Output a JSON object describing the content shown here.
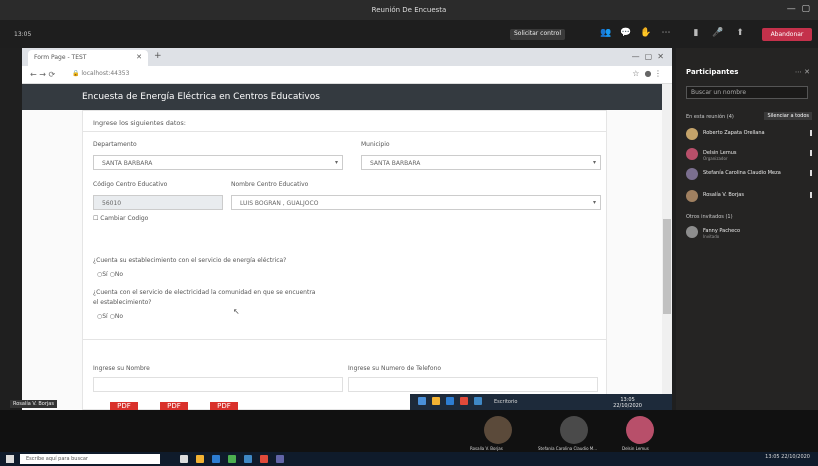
{
  "teams": {
    "window_title": "Reunión De Encuesta",
    "meeting_time": "13:05",
    "control_button": "Solicitar control",
    "leave_button": "Abandonar"
  },
  "browser": {
    "tab_title": "Form Page - TEST",
    "url": "localhost:44353"
  },
  "page": {
    "navbar_title": "Encuesta de Energía Eléctrica en Centros Educativos",
    "instruction": "Ingrese los siguientes datos:",
    "departamento_label": "Departamento",
    "departamento_value": "SANTA BARBARA",
    "municipio_label": "Municipio",
    "municipio_value": "SANTA BARBARA",
    "codigo_label": "Código Centro Educativo",
    "codigo_value": "56010",
    "nombre_centro_label": "Nombre Centro Educativo",
    "nombre_centro_value": "LUIS BOGRAN , GUALJOCO",
    "cambiar_codigo": "Cambiar Codigo",
    "q1": "¿Cuenta su establecimiento con el servicio de energía eléctrica?",
    "q2_line1": "¿Cuenta con el servicio de electricidad la comunidad en que se encuentra",
    "q2_line2": "el establecimiento?",
    "opt_si": "Sí",
    "opt_no": "No",
    "nombre_label": "Ingrese su Nombre",
    "telefono_label": "Ingrese su Numero de Telefono",
    "pdf_label": "PDF"
  },
  "shared_taskbar": {
    "app_label": "Escritorio",
    "clock_time": "13:05",
    "clock_date": "22/10/2020"
  },
  "name_tag": "Rosalía V. Borjas",
  "participants": {
    "header": "Participantes",
    "search_placeholder": "Buscar un nombre",
    "in_meeting_label": "En esta reunión (4)",
    "mute_all": "Silenciar a todos",
    "others_label": "Otros invitados (1)",
    "list": [
      {
        "name": "Roberto Zapata Orellana",
        "sub": "",
        "color": "#c4a36a"
      },
      {
        "name": "Delsin Lemus",
        "sub": "Organizador",
        "color": "#b84f6a"
      },
      {
        "name": "Stefanía Carolina Claudio Meza",
        "sub": "",
        "color": "#7b6f8f"
      },
      {
        "name": "Rosalía V. Borjas",
        "sub": "",
        "color": "#a08060"
      }
    ],
    "others": [
      {
        "name": "Fanny Pacheco",
        "sub": "Invitado",
        "color": "#8d8d8d"
      }
    ]
  },
  "video_strip": [
    {
      "name": "Rosalía V. Borjas",
      "color": "#5b4a3a"
    },
    {
      "name": "Stefanía Carolina Claudio M...",
      "color": "#4a4a4a"
    },
    {
      "name": "Delsin Lemus",
      "color": "#b84f6a"
    }
  ],
  "taskbar": {
    "search_placeholder": "Escribe aquí para buscar",
    "time": "13:05",
    "date": "22/10/2020"
  }
}
